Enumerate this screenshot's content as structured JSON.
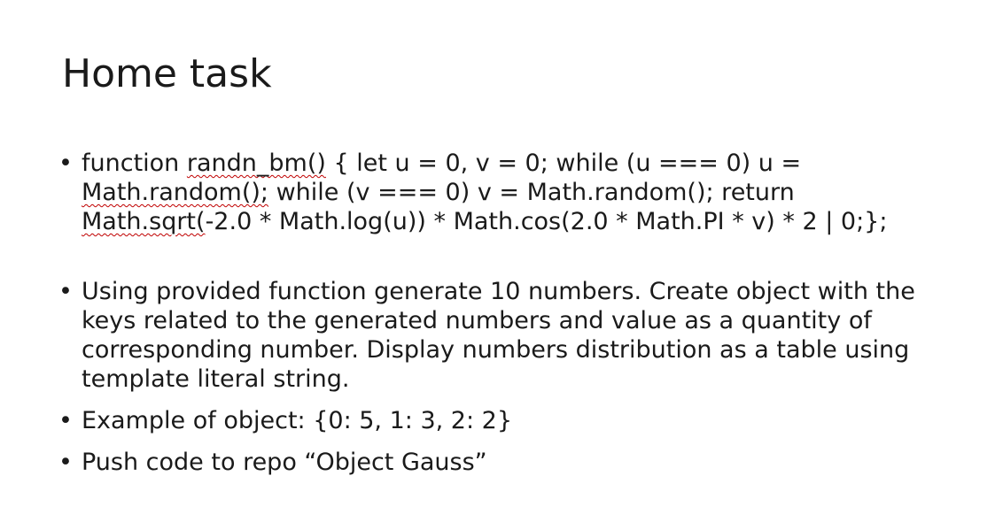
{
  "slide": {
    "title": "Home task",
    "bullets": [
      {
        "lines": [
          {
            "pre": "function ",
            "sq": "randn_bm()",
            "post": " {  let u = 0, v = 0;  while (u === 0) u ="
          },
          {
            "pre": "",
            "sq": "Math.random();",
            "post": "  while (v === 0) v = Math.random();  return"
          },
          {
            "pre": "",
            "sq": "Math.sqrt(",
            "post": "-2.0 * Math.log(u)) * Math.cos(2.0 * Math.PI * v) * 2 | 0;};"
          }
        ]
      },
      {
        "lines": [
          "Using provided function generate 10 numbers. Create object with the",
          "keys related to the generated numbers and value as a quantity of",
          "corresponding number. Display numbers distribution as a table using",
          "template literal string."
        ]
      },
      {
        "lines": [
          "Example of object: {0: 5, 1: 3, 2: 2}"
        ]
      },
      {
        "lines": [
          "Push code to repo “Object Gauss”"
        ]
      }
    ],
    "bullet_glyph": "•"
  }
}
